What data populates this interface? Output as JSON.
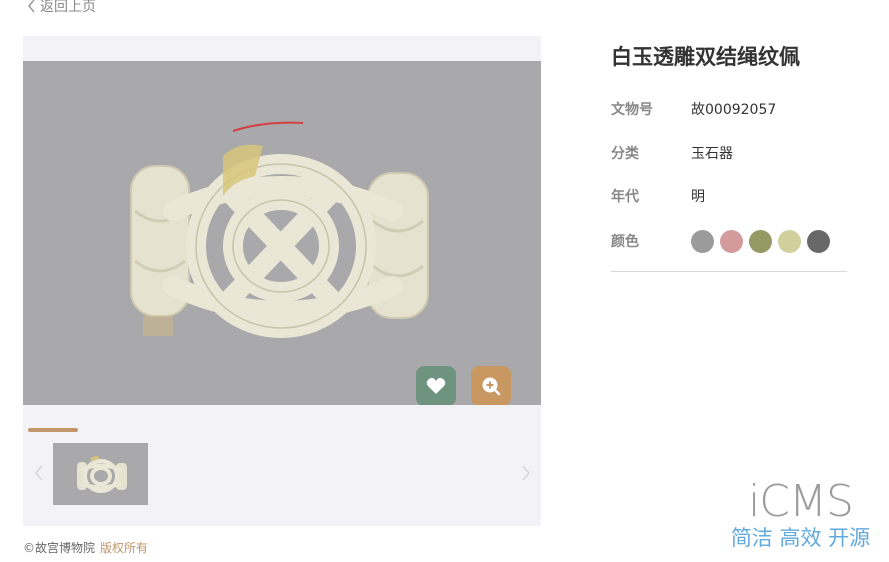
{
  "nav": {
    "back_label": "返回上页",
    "back_icon": "chevron-left-icon"
  },
  "artifact": {
    "title": "白玉透雕双结绳纹佩",
    "fields": [
      {
        "label": "文物号",
        "value": "故00092057"
      },
      {
        "label": "分类",
        "value": "玉石器"
      },
      {
        "label": "年代",
        "value": "明"
      }
    ],
    "color_label": "颜色",
    "colors": [
      "#9b9b9b",
      "#d39b9c",
      "#959a65",
      "#d1d09c",
      "#686868"
    ]
  },
  "viewer": {
    "like_icon": "heart-icon",
    "zoom_icon": "zoom-in-icon",
    "prev_icon": "chevron-left-icon",
    "next_icon": "chevron-right-icon",
    "accent_color": "#c0966a"
  },
  "footer": {
    "copyright": "©故宫博物院",
    "rights": "版权所有"
  },
  "watermark": {
    "logo": "iCMS",
    "slogan": "简洁 高效 开源"
  }
}
